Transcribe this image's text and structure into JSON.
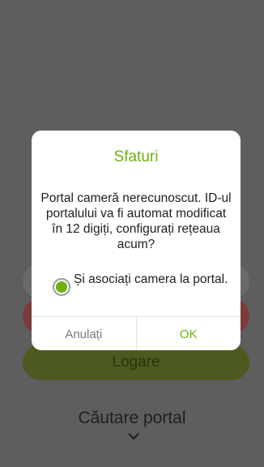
{
  "background": {
    "login_label": "Logare",
    "search_portal_label": "Căutare portal"
  },
  "dialog": {
    "title": "Sfaturi",
    "message": "Portal cameră nerecunoscut. ID-ul portalului va fi automat modificat în 12 digiți, configurați rețeaua acum?",
    "checkbox_label": "Și asociați camera la portal.",
    "checkbox_checked": true,
    "cancel_label": "Anulați",
    "ok_label": "OK"
  },
  "colors": {
    "accent": "#6fb010",
    "overlay": "#5e5e5e"
  },
  "icons": {
    "expand": "chevron-down-icon",
    "radio": "radio-checked-icon"
  }
}
